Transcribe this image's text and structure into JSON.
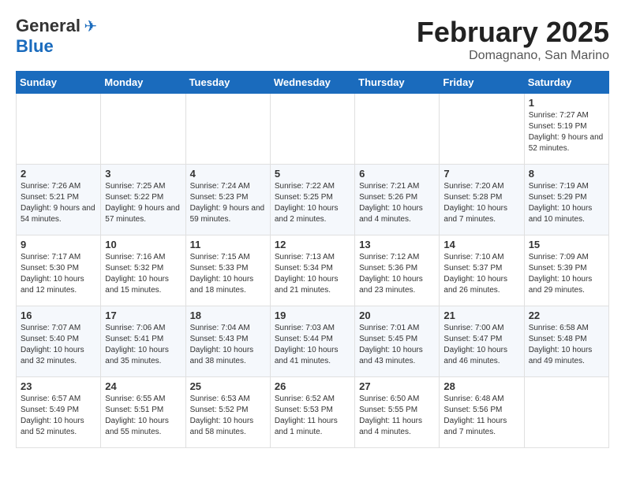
{
  "header": {
    "logo_general": "General",
    "logo_blue": "Blue",
    "month_title": "February 2025",
    "location": "Domagnano, San Marino"
  },
  "days_of_week": [
    "Sunday",
    "Monday",
    "Tuesday",
    "Wednesday",
    "Thursday",
    "Friday",
    "Saturday"
  ],
  "weeks": [
    [
      {
        "day": "",
        "info": ""
      },
      {
        "day": "",
        "info": ""
      },
      {
        "day": "",
        "info": ""
      },
      {
        "day": "",
        "info": ""
      },
      {
        "day": "",
        "info": ""
      },
      {
        "day": "",
        "info": ""
      },
      {
        "day": "1",
        "info": "Sunrise: 7:27 AM\nSunset: 5:19 PM\nDaylight: 9 hours and 52 minutes."
      }
    ],
    [
      {
        "day": "2",
        "info": "Sunrise: 7:26 AM\nSunset: 5:21 PM\nDaylight: 9 hours and 54 minutes."
      },
      {
        "day": "3",
        "info": "Sunrise: 7:25 AM\nSunset: 5:22 PM\nDaylight: 9 hours and 57 minutes."
      },
      {
        "day": "4",
        "info": "Sunrise: 7:24 AM\nSunset: 5:23 PM\nDaylight: 9 hours and 59 minutes."
      },
      {
        "day": "5",
        "info": "Sunrise: 7:22 AM\nSunset: 5:25 PM\nDaylight: 10 hours and 2 minutes."
      },
      {
        "day": "6",
        "info": "Sunrise: 7:21 AM\nSunset: 5:26 PM\nDaylight: 10 hours and 4 minutes."
      },
      {
        "day": "7",
        "info": "Sunrise: 7:20 AM\nSunset: 5:28 PM\nDaylight: 10 hours and 7 minutes."
      },
      {
        "day": "8",
        "info": "Sunrise: 7:19 AM\nSunset: 5:29 PM\nDaylight: 10 hours and 10 minutes."
      }
    ],
    [
      {
        "day": "9",
        "info": "Sunrise: 7:17 AM\nSunset: 5:30 PM\nDaylight: 10 hours and 12 minutes."
      },
      {
        "day": "10",
        "info": "Sunrise: 7:16 AM\nSunset: 5:32 PM\nDaylight: 10 hours and 15 minutes."
      },
      {
        "day": "11",
        "info": "Sunrise: 7:15 AM\nSunset: 5:33 PM\nDaylight: 10 hours and 18 minutes."
      },
      {
        "day": "12",
        "info": "Sunrise: 7:13 AM\nSunset: 5:34 PM\nDaylight: 10 hours and 21 minutes."
      },
      {
        "day": "13",
        "info": "Sunrise: 7:12 AM\nSunset: 5:36 PM\nDaylight: 10 hours and 23 minutes."
      },
      {
        "day": "14",
        "info": "Sunrise: 7:10 AM\nSunset: 5:37 PM\nDaylight: 10 hours and 26 minutes."
      },
      {
        "day": "15",
        "info": "Sunrise: 7:09 AM\nSunset: 5:39 PM\nDaylight: 10 hours and 29 minutes."
      }
    ],
    [
      {
        "day": "16",
        "info": "Sunrise: 7:07 AM\nSunset: 5:40 PM\nDaylight: 10 hours and 32 minutes."
      },
      {
        "day": "17",
        "info": "Sunrise: 7:06 AM\nSunset: 5:41 PM\nDaylight: 10 hours and 35 minutes."
      },
      {
        "day": "18",
        "info": "Sunrise: 7:04 AM\nSunset: 5:43 PM\nDaylight: 10 hours and 38 minutes."
      },
      {
        "day": "19",
        "info": "Sunrise: 7:03 AM\nSunset: 5:44 PM\nDaylight: 10 hours and 41 minutes."
      },
      {
        "day": "20",
        "info": "Sunrise: 7:01 AM\nSunset: 5:45 PM\nDaylight: 10 hours and 43 minutes."
      },
      {
        "day": "21",
        "info": "Sunrise: 7:00 AM\nSunset: 5:47 PM\nDaylight: 10 hours and 46 minutes."
      },
      {
        "day": "22",
        "info": "Sunrise: 6:58 AM\nSunset: 5:48 PM\nDaylight: 10 hours and 49 minutes."
      }
    ],
    [
      {
        "day": "23",
        "info": "Sunrise: 6:57 AM\nSunset: 5:49 PM\nDaylight: 10 hours and 52 minutes."
      },
      {
        "day": "24",
        "info": "Sunrise: 6:55 AM\nSunset: 5:51 PM\nDaylight: 10 hours and 55 minutes."
      },
      {
        "day": "25",
        "info": "Sunrise: 6:53 AM\nSunset: 5:52 PM\nDaylight: 10 hours and 58 minutes."
      },
      {
        "day": "26",
        "info": "Sunrise: 6:52 AM\nSunset: 5:53 PM\nDaylight: 11 hours and 1 minute."
      },
      {
        "day": "27",
        "info": "Sunrise: 6:50 AM\nSunset: 5:55 PM\nDaylight: 11 hours and 4 minutes."
      },
      {
        "day": "28",
        "info": "Sunrise: 6:48 AM\nSunset: 5:56 PM\nDaylight: 11 hours and 7 minutes."
      },
      {
        "day": "",
        "info": ""
      }
    ]
  ]
}
